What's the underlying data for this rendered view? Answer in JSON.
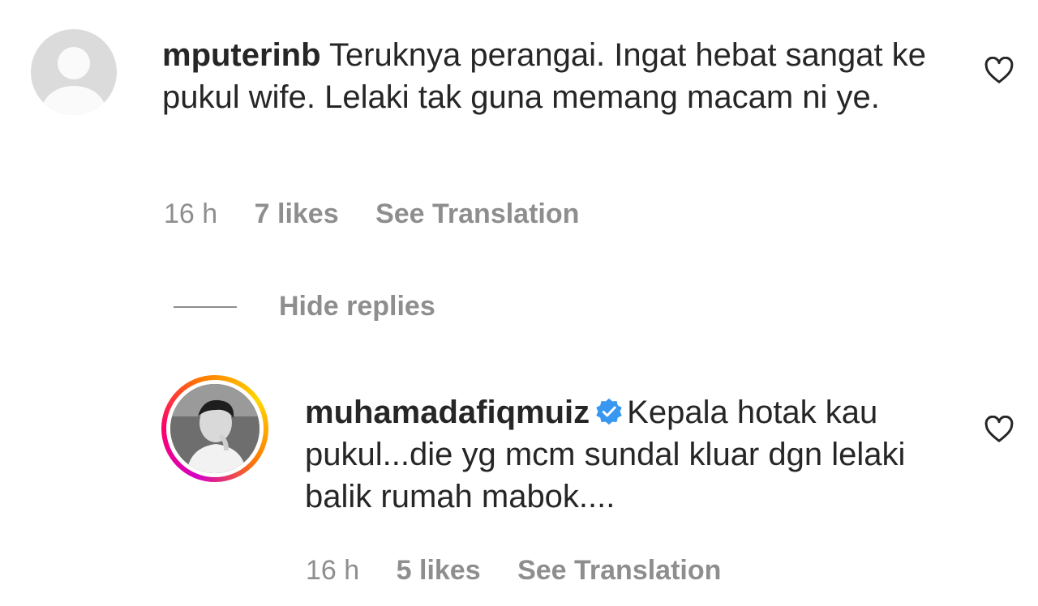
{
  "comment1": {
    "username": "mputerinb",
    "text": "Teruknya perangai. Ingat hebat sangat ke pukul wife. Lelaki tak guna memang macam ni ye.",
    "time": "16 h",
    "likes": "7 likes",
    "translate": "See Translation",
    "icons": {
      "avatar": "default-avatar-icon",
      "like": "heart-icon"
    }
  },
  "replies_toggle": {
    "label": "Hide replies"
  },
  "comment2": {
    "username": "muhamadafiqmuiz",
    "text": "Kepala hotak kau pukul...die yg mcm sundal kluar dgn lelaki balik rumah mabok....",
    "time": "16 h",
    "likes": "5 likes",
    "translate": "See Translation",
    "verified": true,
    "icons": {
      "avatar": "story-ring-avatar",
      "verified": "verified-badge-icon",
      "like": "heart-icon"
    }
  },
  "colors": {
    "text": "#262626",
    "secondary": "#8e8e8e",
    "verified": "#3897f0",
    "avatar_placeholder": "#dbdbdb"
  }
}
